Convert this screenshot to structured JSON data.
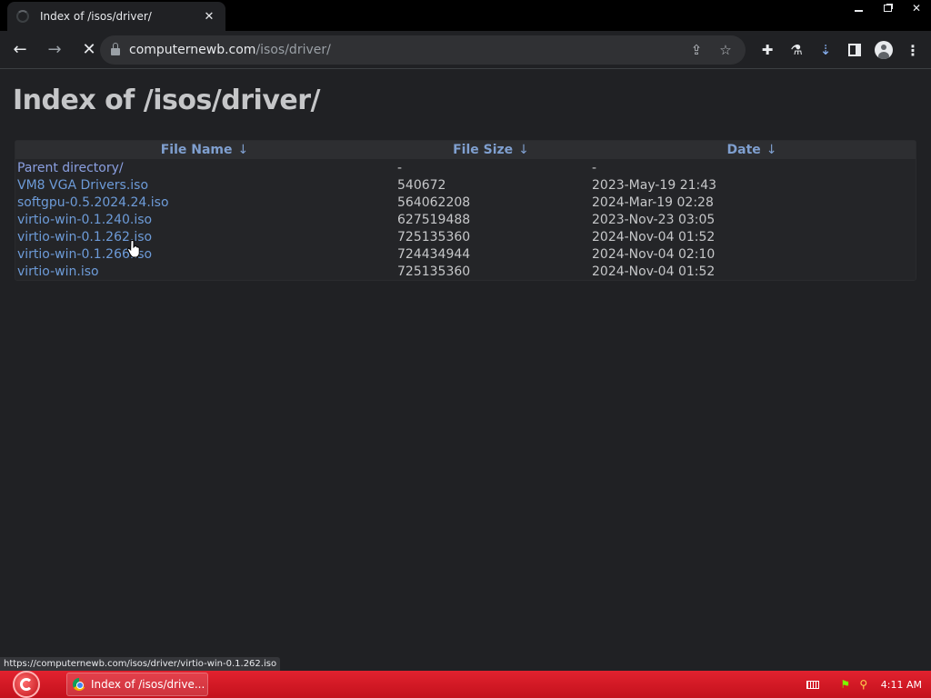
{
  "browser": {
    "tab": {
      "title": "Index of /isos/driver/",
      "close_glyph": "✕"
    },
    "window_controls": {
      "close_glyph": "✕"
    },
    "toolbar": {
      "back_glyph": "←",
      "forward_glyph": "→",
      "stop_glyph": "✕",
      "url_host": "computernewb.com",
      "url_path": "/isos/driver/",
      "share_glyph": "⇪",
      "star_glyph": "☆",
      "extensions_glyph": "✚",
      "labs_glyph": "⚗",
      "download_glyph": "⇣",
      "menu_glyph": "⋮"
    },
    "status_url": "https://computernewb.com/isos/driver/virtio-win-0.1.262.iso"
  },
  "page": {
    "title": "Index of /isos/driver/",
    "columns": [
      {
        "label": "File Name",
        "sort_glyph": "↓"
      },
      {
        "label": "File Size",
        "sort_glyph": "↓"
      },
      {
        "label": "Date",
        "sort_glyph": "↓"
      }
    ],
    "rows": [
      {
        "name": "Parent directory/",
        "size": "-",
        "date": "-"
      },
      {
        "name": "VM8 VGA Drivers.iso",
        "size": "540672",
        "date": "2023-May-19 21:43"
      },
      {
        "name": "softgpu-0.5.2024.24.iso",
        "size": "564062208",
        "date": "2024-Mar-19 02:28"
      },
      {
        "name": "virtio-win-0.1.240.iso",
        "size": "627519488",
        "date": "2023-Nov-23 03:05"
      },
      {
        "name": "virtio-win-0.1.262.iso",
        "size": "725135360",
        "date": "2024-Nov-04 01:52"
      },
      {
        "name": "virtio-win-0.1.266.iso",
        "size": "724434944",
        "date": "2024-Nov-04 02:10"
      },
      {
        "name": "virtio-win.iso",
        "size": "725135360",
        "date": "2024-Nov-04 01:52"
      }
    ]
  },
  "taskbar": {
    "task_label": "Index of /isos/drive...",
    "clock": "4:11 AM",
    "tray_glyph": "⚲"
  },
  "colors": {
    "background": "#202124",
    "link": "#6d9bd8",
    "taskbar": "#d0141f"
  }
}
